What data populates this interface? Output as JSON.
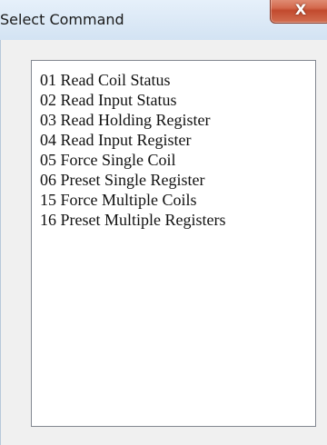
{
  "window": {
    "title": "Select Command",
    "close_label": "X"
  },
  "commands": [
    "01 Read Coil Status",
    "02 Read Input Status",
    "03 Read Holding Register",
    "04 Read Input Register",
    "05 Force Single Coil",
    "06 Preset Single Register",
    "15 Force Multiple Coils",
    "16 Preset Multiple Registers"
  ],
  "colors": {
    "titlebar": "#d6e5f4",
    "close_button": "#c94e33",
    "list_background": "#ffffff",
    "dialog_background": "#f0f0f0"
  }
}
